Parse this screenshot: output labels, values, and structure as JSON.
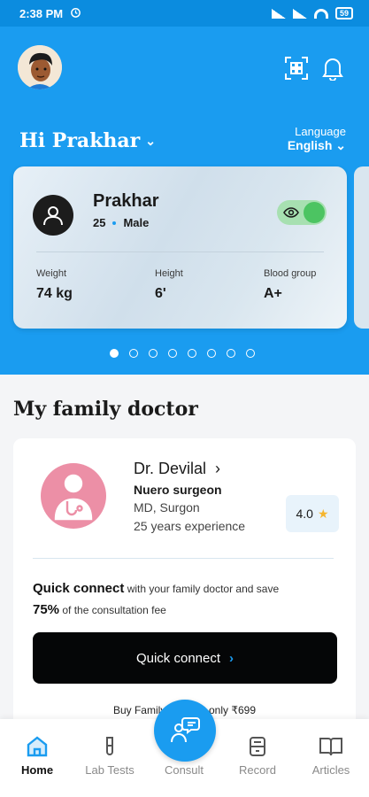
{
  "status_bar": {
    "time": "2:38 PM",
    "battery": "59"
  },
  "header": {
    "greeting": "Hi Prakhar",
    "language_label": "Language",
    "language_value": "English"
  },
  "profile": {
    "name": "Prakhar",
    "age": "25",
    "gender": "Male",
    "visibility_toggle": "on",
    "stats": [
      {
        "label": "Weight",
        "value": "74 kg"
      },
      {
        "label": "Height",
        "value": "6'"
      },
      {
        "label": "Blood group",
        "value": "A+"
      }
    ]
  },
  "carousel": {
    "total": 8,
    "active": 1
  },
  "family_doctor": {
    "section_title": "My family doctor",
    "name": "Dr. Devilal",
    "specialty": "Nuero surgeon",
    "degree": "MD, Surgon",
    "experience": "25 years experience",
    "rating": "4.0",
    "quick_connect_title": "Quick connect",
    "quick_connect_desc": "with your family doctor and save",
    "discount": "75%",
    "discount_desc": "of the consultation fee",
    "button_label": "Quick connect",
    "plan_text": "Buy Family plans at only ₹699"
  },
  "bottom_nav": [
    {
      "label": "Home",
      "icon": "home-icon",
      "active": true
    },
    {
      "label": "Lab Tests",
      "icon": "test-tube-icon",
      "active": false
    },
    {
      "label": "Consult",
      "icon": "consult-icon",
      "active": false
    },
    {
      "label": "Record",
      "icon": "record-icon",
      "active": false
    },
    {
      "label": "Articles",
      "icon": "book-icon",
      "active": false
    }
  ],
  "colors": {
    "primary": "#1a9cf0",
    "dark": "#050607",
    "toggle_on": "#4cc462",
    "star": "#f5b52e"
  }
}
